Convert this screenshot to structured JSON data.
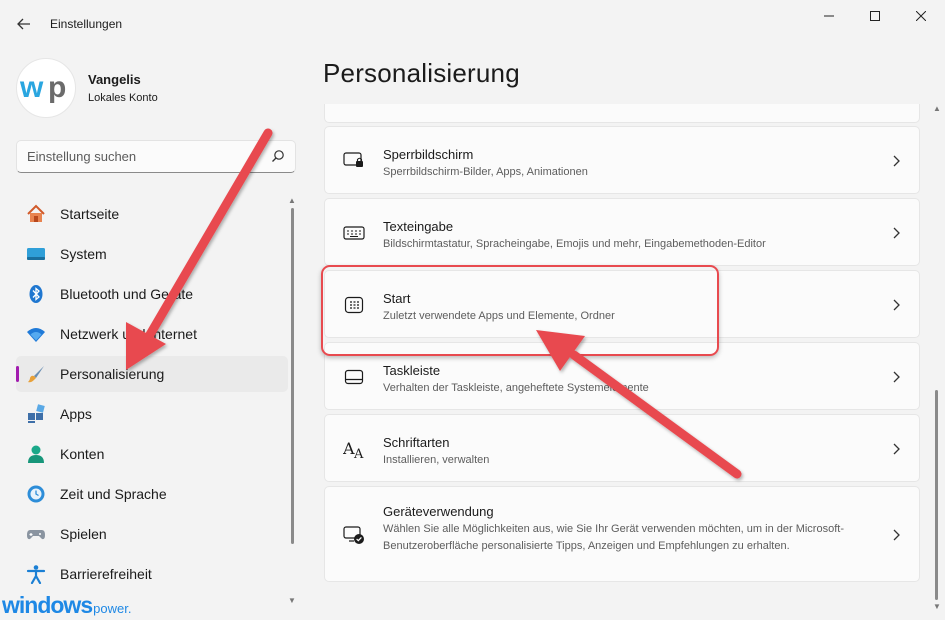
{
  "window": {
    "app_title": "Einstellungen",
    "back_icon": "back-arrow-icon",
    "minimize_icon": "minimize-icon",
    "maximize_icon": "maximize-icon",
    "close_icon": "close-icon"
  },
  "user": {
    "name": "Vangelis",
    "account_type": "Lokales Konto",
    "avatar_logo": "wp"
  },
  "search": {
    "placeholder": "Einstellung suchen"
  },
  "sidebar": {
    "items": [
      {
        "label": "Startseite",
        "icon": "home-icon",
        "active": false
      },
      {
        "label": "System",
        "icon": "monitor-icon",
        "active": false
      },
      {
        "label": "Bluetooth und Geräte",
        "icon": "bluetooth-icon",
        "active": false
      },
      {
        "label": "Netzwerk und Internet",
        "icon": "wifi-icon",
        "active": false
      },
      {
        "label": "Personalisierung",
        "icon": "brush-icon",
        "active": true
      },
      {
        "label": "Apps",
        "icon": "apps-icon",
        "active": false
      },
      {
        "label": "Konten",
        "icon": "person-icon",
        "active": false
      },
      {
        "label": "Zeit und Sprache",
        "icon": "clock-globe-icon",
        "active": false
      },
      {
        "label": "Spielen",
        "icon": "gamepad-icon",
        "active": false
      },
      {
        "label": "Barrierefreiheit",
        "icon": "accessibility-icon",
        "active": false
      }
    ]
  },
  "main": {
    "title": "Personalisierung",
    "cards": [
      {
        "title": "Sperrbildschirm",
        "desc": "Sperrbildschirm-Bilder, Apps, Animationen",
        "icon": "lock-screen-icon"
      },
      {
        "title": "Texteingabe",
        "desc": "Bildschirmtastatur, Spracheingabe, Emojis und mehr, Eingabemethoden-Editor",
        "icon": "keyboard-icon"
      },
      {
        "title": "Start",
        "desc": "Zuletzt verwendete Apps und Elemente, Ordner",
        "icon": "start-menu-icon"
      },
      {
        "title": "Taskleiste",
        "desc": "Verhalten der Taskleiste, angeheftete Systemelemente",
        "icon": "taskbar-icon"
      },
      {
        "title": "Schriftarten",
        "desc": "Installieren, verwalten",
        "icon": "fonts-icon"
      },
      {
        "title": "Geräteverwendung",
        "desc": "Wählen Sie alle Möglichkeiten aus, wie Sie Ihr Gerät verwenden möchten, um in der Microsoft-Benutzeroberfläche personalisierte Tipps, Anzeigen und Empfehlungen zu erhalten.",
        "icon": "device-usage-icon"
      }
    ]
  },
  "watermark": {
    "main": "windows",
    "sub": "power."
  },
  "colors": {
    "accent": "#a21caf",
    "annotation": "#e84a4f",
    "watermark": "#1e88e5"
  }
}
